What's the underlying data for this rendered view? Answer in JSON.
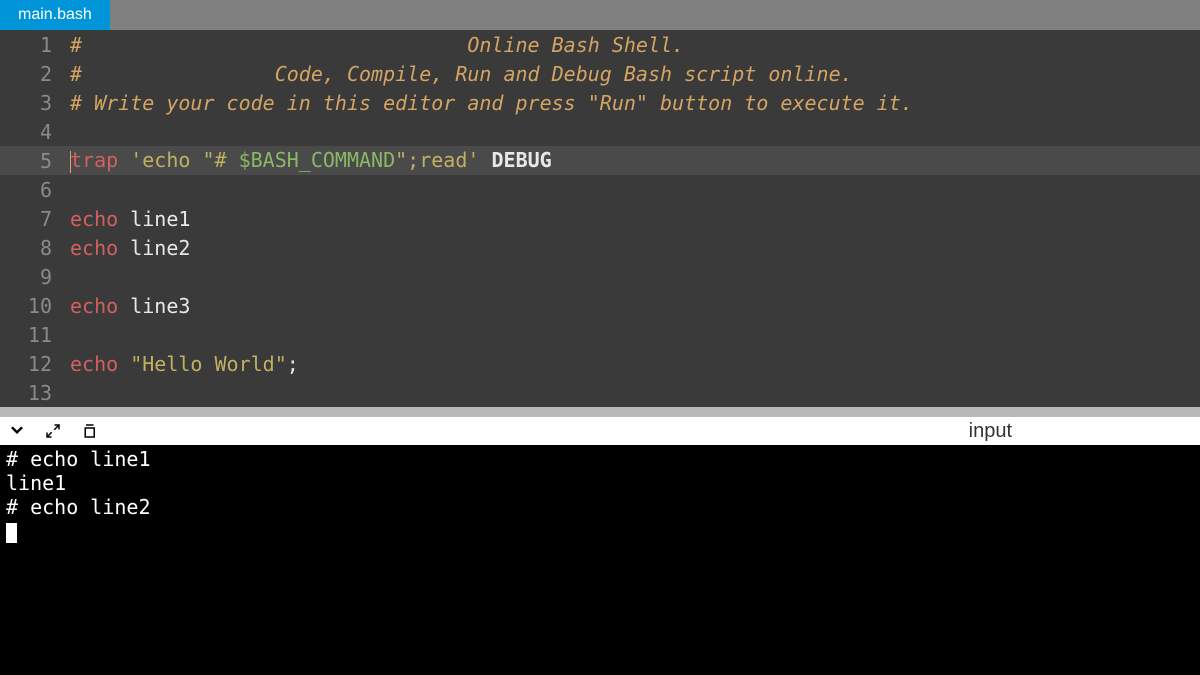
{
  "tab": {
    "name": "main.bash"
  },
  "editor": {
    "active_line": 5,
    "lines": [
      {
        "n": 1,
        "tokens": [
          {
            "cls": "comment",
            "t": "#                                Online Bash Shell."
          }
        ]
      },
      {
        "n": 2,
        "tokens": [
          {
            "cls": "comment",
            "t": "#                Code, Compile, Run and Debug Bash script online."
          }
        ]
      },
      {
        "n": 3,
        "tokens": [
          {
            "cls": "comment",
            "t": "# Write your code in this editor and press \"Run\" button to execute it."
          }
        ]
      },
      {
        "n": 4,
        "tokens": []
      },
      {
        "n": 5,
        "tokens": [
          {
            "cls": "keyword",
            "t": "trap"
          },
          {
            "cls": "plain",
            "t": " "
          },
          {
            "cls": "string",
            "t": "'echo \"# "
          },
          {
            "cls": "var",
            "t": "$BASH_COMMAND"
          },
          {
            "cls": "string",
            "t": "\";read'"
          },
          {
            "cls": "plain",
            "t": " "
          },
          {
            "cls": "debug-kw",
            "t": "DEBUG"
          }
        ]
      },
      {
        "n": 6,
        "tokens": []
      },
      {
        "n": 7,
        "tokens": [
          {
            "cls": "keyword",
            "t": "echo"
          },
          {
            "cls": "plain",
            "t": " "
          },
          {
            "cls": "identifier",
            "t": "line1"
          }
        ]
      },
      {
        "n": 8,
        "tokens": [
          {
            "cls": "keyword",
            "t": "echo"
          },
          {
            "cls": "plain",
            "t": " "
          },
          {
            "cls": "identifier",
            "t": "line2"
          }
        ]
      },
      {
        "n": 9,
        "tokens": []
      },
      {
        "n": 10,
        "tokens": [
          {
            "cls": "keyword",
            "t": "echo"
          },
          {
            "cls": "plain",
            "t": " "
          },
          {
            "cls": "identifier",
            "t": "line3"
          }
        ]
      },
      {
        "n": 11,
        "tokens": []
      },
      {
        "n": 12,
        "tokens": [
          {
            "cls": "keyword",
            "t": "echo"
          },
          {
            "cls": "plain",
            "t": " "
          },
          {
            "cls": "string",
            "t": "\"Hello World\""
          },
          {
            "cls": "plain",
            "t": ";"
          }
        ]
      },
      {
        "n": 13,
        "tokens": []
      }
    ]
  },
  "toolbar": {
    "input_label": "input"
  },
  "terminal": {
    "lines": [
      "# echo line1",
      "",
      "line1",
      "# echo line2"
    ]
  }
}
